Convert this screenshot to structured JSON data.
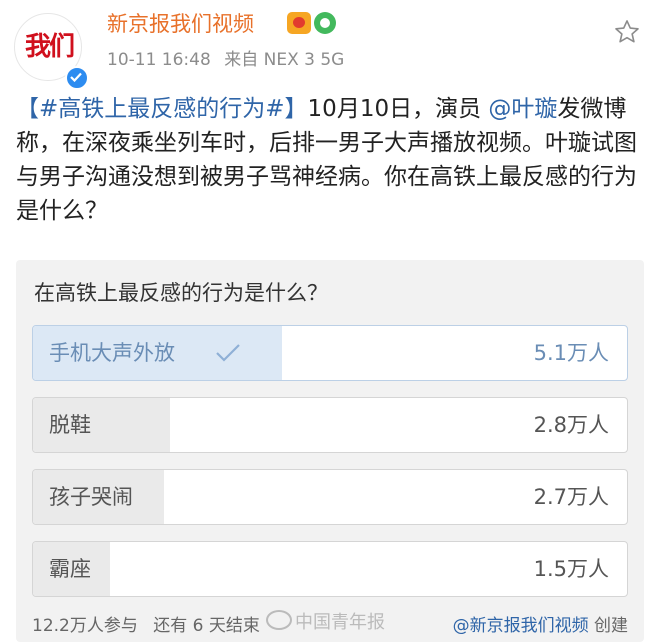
{
  "header": {
    "avatar_text": "我们",
    "username": "新京报我们视频",
    "time": "10-11 16:48",
    "source": "来自 NEX 3 5G",
    "badge_a_icon": "vip-icon",
    "badge_b_icon": "membership-icon",
    "verified_icon": "verified-check-icon",
    "favorite_icon": "star-icon"
  },
  "post": {
    "hashtag": "【#高铁上最反感的行为#】",
    "text_before_mention": "10月10日，演员",
    "mention": "@叶璇",
    "text_after_mention": "发微博称，在深夜乘坐列车时，后排一男子大声播放视频。叶璇试图与男子沟通没想到被男子骂神经病。你在高铁上最反感的行为是什么？"
  },
  "poll": {
    "question": "在高铁上最反感的行为是什么？",
    "options": [
      {
        "label": "手机大声外放",
        "count": "5.1万人",
        "fraction": 0.42,
        "selected": true
      },
      {
        "label": "脱鞋",
        "count": "2.8万人",
        "fraction": 0.23,
        "selected": false
      },
      {
        "label": "孩子哭闹",
        "count": "2.7万人",
        "fraction": 0.22,
        "selected": false
      },
      {
        "label": "霸座",
        "count": "1.5万人",
        "fraction": 0.13,
        "selected": false
      }
    ],
    "participants": "12.2万人参与",
    "ends": "还有 6 天结束",
    "creator_prefix": "@",
    "creator_name": "新京报我们视频",
    "creator_suffix": " 创建"
  },
  "watermark": {
    "text": "中国青年报"
  },
  "colors": {
    "username": "#e8712a",
    "link": "#2f65a8",
    "selected_bar": "#dce8f5",
    "bar": "#eaeaea"
  }
}
